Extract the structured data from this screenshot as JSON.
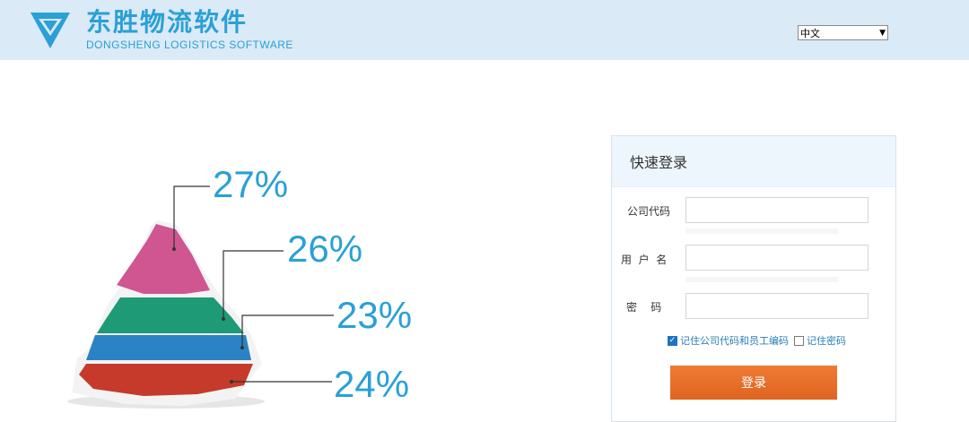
{
  "header": {
    "brand_cn": "东胜物流软件",
    "brand_en": "DONGSHENG LOGISTICS SOFTWARE",
    "logo_icon": "diamond-logo-icon",
    "language": {
      "selected": "中文"
    }
  },
  "illustration": {
    "labels": [
      "27%",
      "26%",
      "23%",
      "24%"
    ],
    "colors": [
      "#cf5690",
      "#1e9a76",
      "#2b82c4",
      "#cc3a2c"
    ]
  },
  "login": {
    "title": "快速登录",
    "company_code_label": "公司代码",
    "company_code_value": "",
    "username_label": "用  户  名",
    "username_value": "",
    "password_label": "密    码",
    "password_value": "",
    "remember_code_label": "记住公司代码和员工编码",
    "remember_code_checked": true,
    "remember_pwd_label": "记住密码",
    "remember_pwd_checked": false,
    "submit_label": "登录"
  },
  "colors": {
    "header_bg": "#daeaf7",
    "brand": "#2aa0d6",
    "button": "#e86c27",
    "link": "#2a7fb8"
  }
}
